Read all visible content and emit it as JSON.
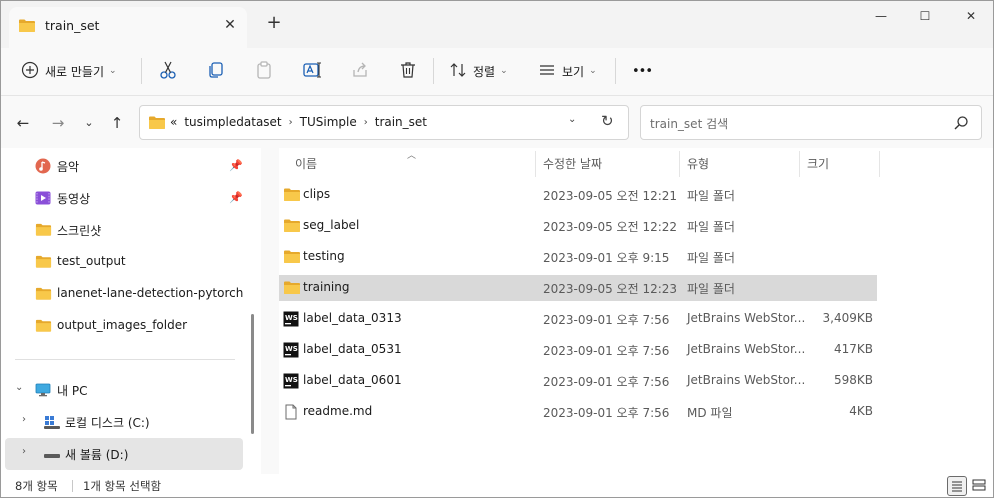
{
  "window": {
    "tab_title": "train_set",
    "tab_close": "✕",
    "new_tab": "+",
    "minimize": "—",
    "maximize": "☐",
    "close": "✕"
  },
  "toolbar": {
    "new_label": "새로 만들기",
    "sort_label": "정렬",
    "view_label": "보기",
    "more_label": "•••"
  },
  "address": {
    "overflow": "«",
    "crumbs": [
      "tusimpledataset",
      "TUSimple",
      "train_set"
    ],
    "sep": "›",
    "search_placeholder": "train_set 검색"
  },
  "sidebar": {
    "quick_access": [
      {
        "label": "음악",
        "icon": "music-icon",
        "pinned": true
      },
      {
        "label": "동영상",
        "icon": "video-icon",
        "pinned": true
      },
      {
        "label": "스크린샷",
        "icon": "folder-icon",
        "pinned": false
      },
      {
        "label": "test_output",
        "icon": "folder-icon",
        "pinned": false
      },
      {
        "label": "lanenet-lane-detection-pytorch",
        "icon": "folder-icon",
        "pinned": false
      },
      {
        "label": "output_images_folder",
        "icon": "folder-icon",
        "pinned": false
      }
    ],
    "this_pc": "내 PC",
    "drives": [
      {
        "label": "로컬 디스크 (C:)"
      },
      {
        "label": "새 볼륨 (D:)"
      }
    ]
  },
  "columns": {
    "name": "이름",
    "date": "수정한 날짜",
    "type": "유형",
    "size": "크기"
  },
  "files": [
    {
      "name": "clips",
      "date": "2023-09-05 오전 12:21",
      "type": "파일 폴더",
      "size": "",
      "kind": "folder"
    },
    {
      "name": "seg_label",
      "date": "2023-09-05 오전 12:22",
      "type": "파일 폴더",
      "size": "",
      "kind": "folder"
    },
    {
      "name": "testing",
      "date": "2023-09-01 오후 9:15",
      "type": "파일 폴더",
      "size": "",
      "kind": "folder"
    },
    {
      "name": "training",
      "date": "2023-09-05 오전 12:23",
      "type": "파일 폴더",
      "size": "",
      "kind": "folder"
    },
    {
      "name": "label_data_0313",
      "date": "2023-09-01 오후 7:56",
      "type": "JetBrains WebStor...",
      "size": "3,409KB",
      "kind": "webstorm"
    },
    {
      "name": "label_data_0531",
      "date": "2023-09-01 오후 7:56",
      "type": "JetBrains WebStor...",
      "size": "417KB",
      "kind": "webstorm"
    },
    {
      "name": "label_data_0601",
      "date": "2023-09-01 오후 7:56",
      "type": "JetBrains WebStor...",
      "size": "598KB",
      "kind": "webstorm"
    },
    {
      "name": "readme.md",
      "date": "2023-09-01 오후 7:56",
      "type": "MD 파일",
      "size": "4KB",
      "kind": "document"
    }
  ],
  "status": {
    "count": "8개 항목",
    "selection": "1개 항목 선택함"
  },
  "colors": {
    "folder": "#f8c84a",
    "folder_dark": "#e6a92c",
    "selected_row": "#d9d9d9",
    "chrome": "#f3f3f3"
  }
}
